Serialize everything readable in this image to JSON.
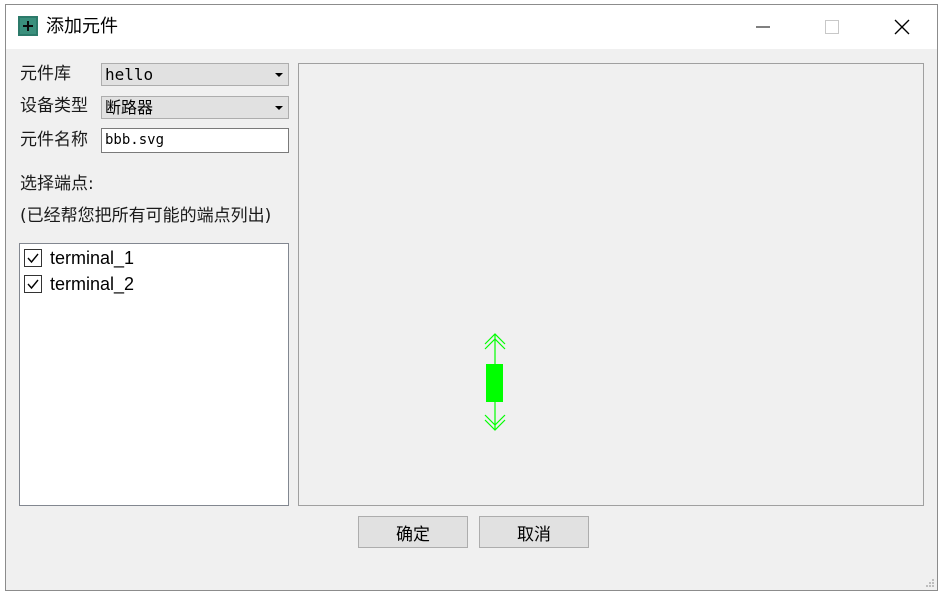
{
  "window": {
    "title": "添加元件",
    "accent_color": "#2c7a6a"
  },
  "form": {
    "library_label": "元件库",
    "library_value": "hello",
    "device_type_label": "设备类型",
    "device_type_value": "断路器",
    "name_label": "元件名称",
    "name_value": "bbb.svg",
    "select_terminals_label": "选择端点:",
    "terminals_hint": "(已经帮您把所有可能的端点列出)"
  },
  "terminals": [
    {
      "label": "terminal_1",
      "checked": true
    },
    {
      "label": "terminal_2",
      "checked": true
    }
  ],
  "preview": {
    "symbol": "circuit-breaker-symbol",
    "symbol_color": "#00ff00"
  },
  "buttons": {
    "ok_label": "确定",
    "cancel_label": "取消"
  }
}
